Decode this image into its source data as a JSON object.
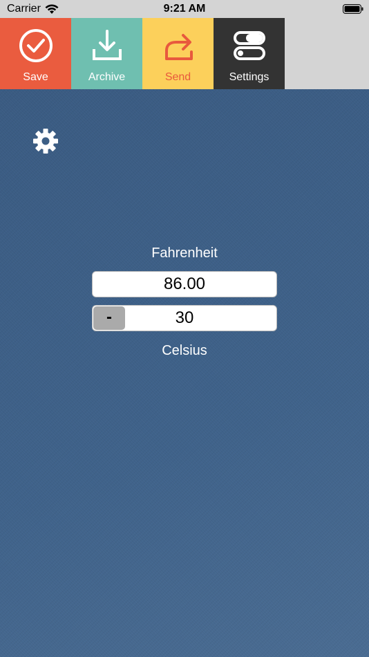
{
  "status_bar": {
    "carrier": "Carrier",
    "time": "9:21 AM"
  },
  "toolbar": {
    "save_label": "Save",
    "archive_label": "Archive",
    "send_label": "Send",
    "settings_label": "Settings"
  },
  "converter": {
    "fahrenheit_label": "Fahrenheit",
    "fahrenheit_value": "86.00",
    "sign_label": "-",
    "celsius_value": "30",
    "celsius_label": "Celsius"
  },
  "colors": {
    "save": "#ea5c3f",
    "archive": "#6fbfb0",
    "send": "#fcd05b",
    "settings": "#333333",
    "background": "#3d5f86"
  },
  "icons": {
    "save": "check-circle-icon",
    "archive": "download-icon",
    "send": "share-arrow-icon",
    "settings": "toggles-icon",
    "gear": "gear-icon"
  }
}
